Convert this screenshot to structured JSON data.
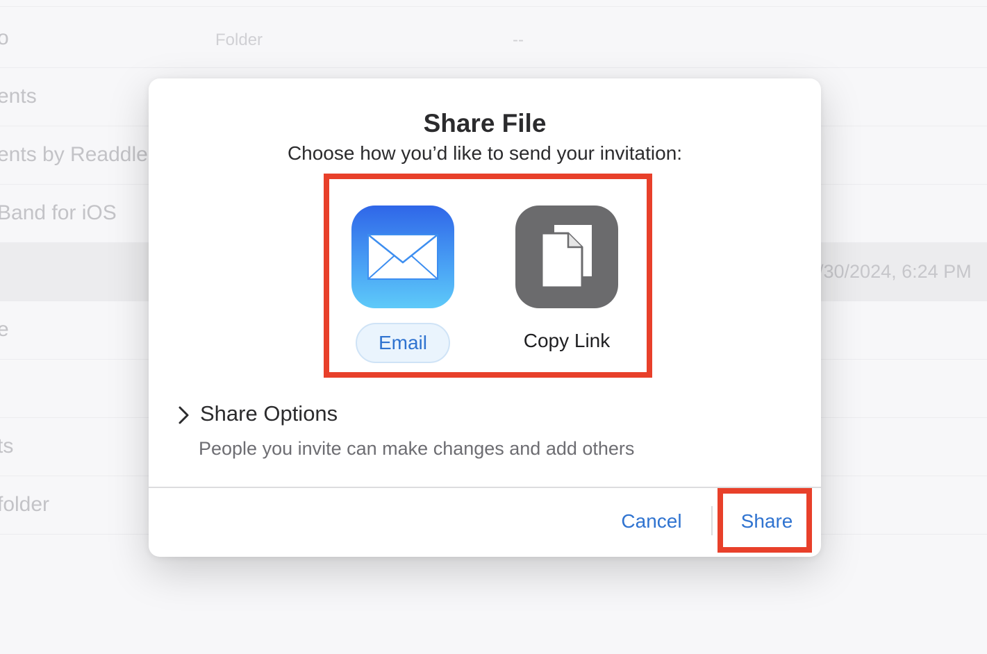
{
  "background": {
    "rows": [
      {
        "name": "o",
        "kind": "Folder",
        "size": "--",
        "date": ""
      },
      {
        "name": "ents",
        "kind": "",
        "size": "",
        "date": ""
      },
      {
        "name": "ents by Readdle",
        "kind": "",
        "size": "",
        "date": ""
      },
      {
        "name": "Band for iOS",
        "kind": "",
        "size": "",
        "date": ""
      },
      {
        "name": "",
        "kind": "",
        "size": "",
        "date": "/30/2024, 6:24 PM"
      },
      {
        "name": "e",
        "kind": "",
        "size": "",
        "date": ""
      },
      {
        "name": "",
        "kind": "",
        "size": "",
        "date": ""
      },
      {
        "name": "ts",
        "kind": "",
        "size": "",
        "date": ""
      },
      {
        "name": " folder",
        "kind": "",
        "size": "",
        "date": ""
      }
    ]
  },
  "dialog": {
    "title": "Share File",
    "subtitle": "Choose how you’d like to send your invitation:",
    "options": {
      "email": {
        "label": "Email",
        "icon": "mail-icon"
      },
      "copy_link": {
        "label": "Copy Link",
        "icon": "copy-documents-icon"
      }
    },
    "share_options": {
      "label": "Share Options",
      "description": "People you invite can make changes and add others"
    },
    "buttons": {
      "cancel": "Cancel",
      "share": "Share"
    }
  },
  "colors": {
    "accent": "#2f73d0",
    "highlight": "#e8402a",
    "mail_gradient_top": "#2f66e8",
    "mail_gradient_bottom": "#5ecaf9",
    "copy_icon_bg": "#6b6b6d"
  }
}
